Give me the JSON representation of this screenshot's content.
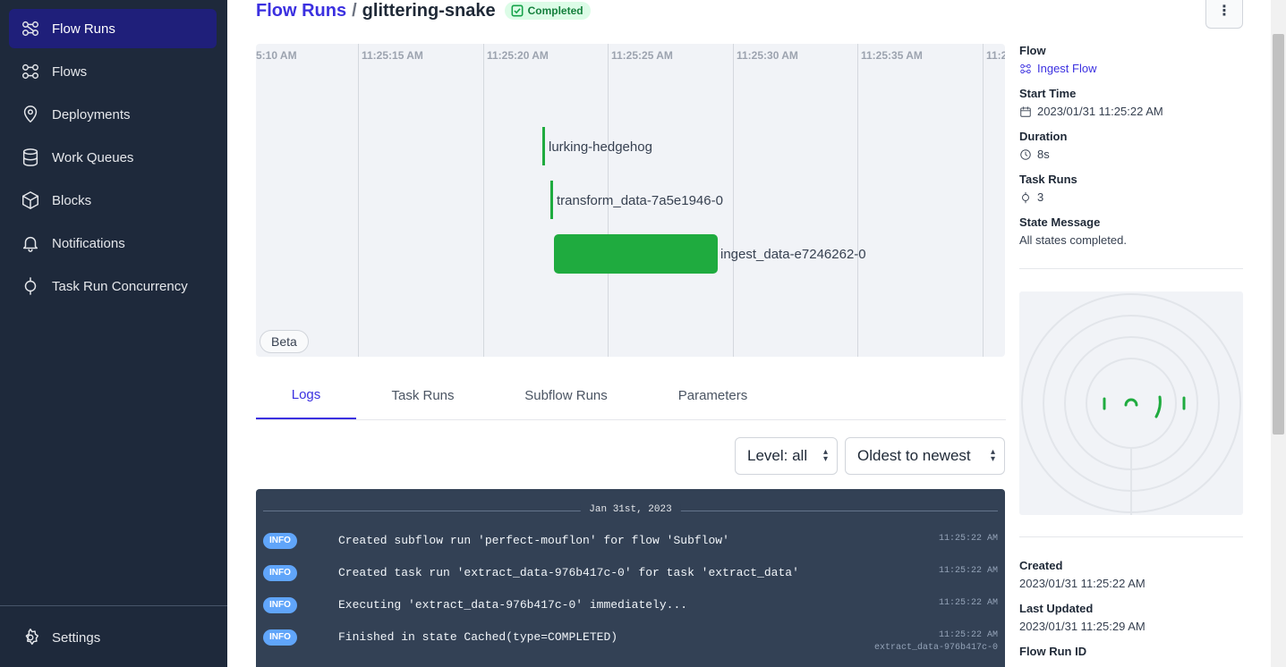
{
  "sidebar": {
    "items": [
      {
        "label": "Flow Runs",
        "icon": "flow-runs-icon",
        "active": true
      },
      {
        "label": "Flows",
        "icon": "flows-icon"
      },
      {
        "label": "Deployments",
        "icon": "map-pin-icon"
      },
      {
        "label": "Work Queues",
        "icon": "database-icon"
      },
      {
        "label": "Blocks",
        "icon": "cube-icon"
      },
      {
        "label": "Notifications",
        "icon": "bell-icon"
      },
      {
        "label": "Task Run Concurrency",
        "icon": "concurrency-icon"
      }
    ],
    "settings": {
      "label": "Settings",
      "icon": "gear-icon"
    }
  },
  "header": {
    "breadcrumb_link": "Flow Runs",
    "separator": "/",
    "run_name": "glittering-snake",
    "state_badge": "Completed",
    "menu_glyph": "⋮"
  },
  "timeline": {
    "ticks": [
      "5:10 AM",
      "11:25:15 AM",
      "11:25:20 AM",
      "11:25:25 AM",
      "11:25:30 AM",
      "11:25:35 AM",
      "11:2"
    ],
    "runs": [
      {
        "label": "lurking-hedgehog"
      },
      {
        "label": "transform_data-7a5e1946-0"
      },
      {
        "label": "ingest_data-e7246262-0"
      }
    ],
    "beta_label": "Beta",
    "bar_color": "#1fab3f"
  },
  "tabs": [
    {
      "label": "Logs",
      "active": true
    },
    {
      "label": "Task Runs"
    },
    {
      "label": "Subflow Runs"
    },
    {
      "label": "Parameters"
    }
  ],
  "filters": {
    "level": "Level: all",
    "sort": "Oldest to newest"
  },
  "logs": {
    "date": "Jan 31st, 2023",
    "rows": [
      {
        "level": "INFO",
        "message": "Created subflow run 'perfect-mouflon' for flow 'Subflow'",
        "time": "11:25:22 AM",
        "source": ""
      },
      {
        "level": "INFO",
        "message": "Created task run 'extract_data-976b417c-0' for task 'extract_data'",
        "time": "11:25:22 AM",
        "source": ""
      },
      {
        "level": "INFO",
        "message": "Executing 'extract_data-976b417c-0' immediately...",
        "time": "11:25:22 AM",
        "source": ""
      },
      {
        "level": "INFO",
        "message": "Finished in state Cached(type=COMPLETED)",
        "time": "11:25:22 AM",
        "source": "extract_data-976b417c-0"
      }
    ]
  },
  "details": {
    "flow_label": "Flow",
    "flow_value": "Ingest Flow",
    "start_label": "Start Time",
    "start_value": "2023/01/31 11:25:22 AM",
    "duration_label": "Duration",
    "duration_value": "8s",
    "task_runs_label": "Task Runs",
    "task_runs_value": "3",
    "state_msg_label": "State Message",
    "state_msg_value": "All states completed.",
    "created_label": "Created",
    "created_value": "2023/01/31 11:25:22 AM",
    "updated_label": "Last Updated",
    "updated_value": "2023/01/31 11:25:29 AM",
    "run_id_label": "Flow Run ID"
  },
  "colors": {
    "sidebar_bg": "#1e293b",
    "accent": "#3b30e0",
    "success": "#16a34a",
    "log_bg": "#334155",
    "info_badge": "#60a5fa"
  }
}
